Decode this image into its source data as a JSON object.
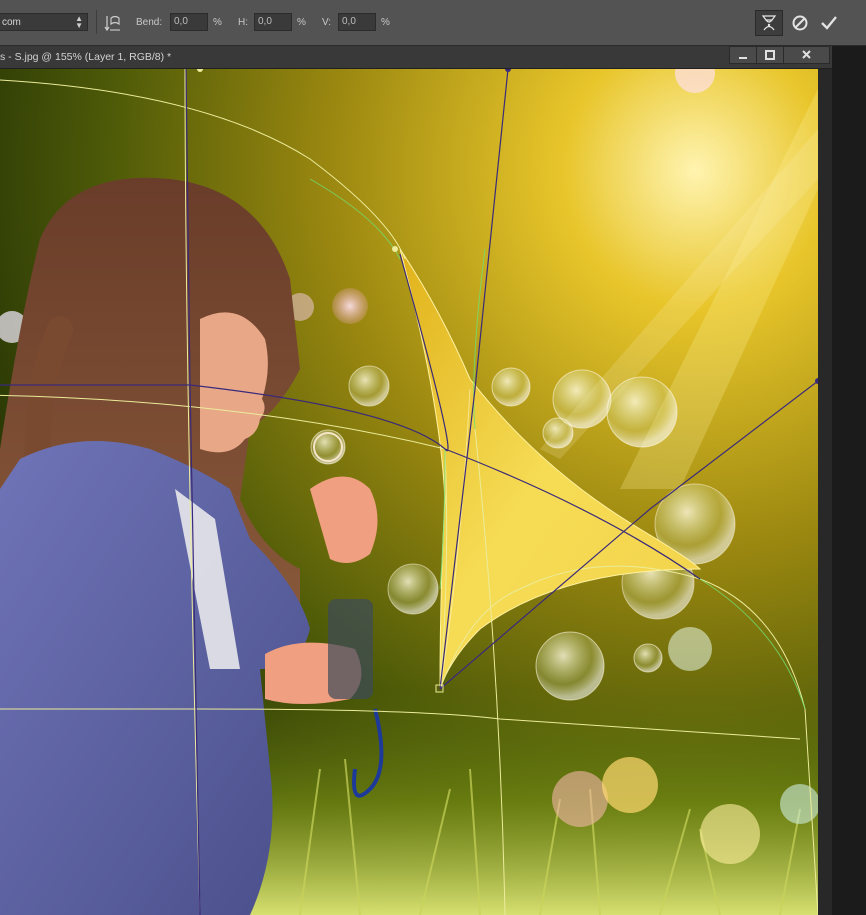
{
  "options_bar": {
    "preset_label": "com",
    "bend_label": "Bend:",
    "bend_value": "0,0",
    "h_label": "H:",
    "h_value": "0,0",
    "v_label": "V:",
    "v_value": "0,0",
    "percent": "%"
  },
  "document": {
    "tab_title": "s - S.jpg @ 155% (Layer 1, RGB/8) *"
  },
  "colors": {
    "toolbar_bg": "#535353",
    "tab_bg": "#393939",
    "warp_mesh": "#e6e690",
    "warp_handle_line": "#3a2a7a",
    "curl_fill": "#f2d33a"
  },
  "icons": {
    "orientation": "warp-orientation-icon",
    "warp_mode": "puppet-warp-icon",
    "cancel": "cancel-icon",
    "commit": "checkmark-icon",
    "minimize": "minimize-icon",
    "restore": "restore-icon",
    "close": "close-icon"
  }
}
